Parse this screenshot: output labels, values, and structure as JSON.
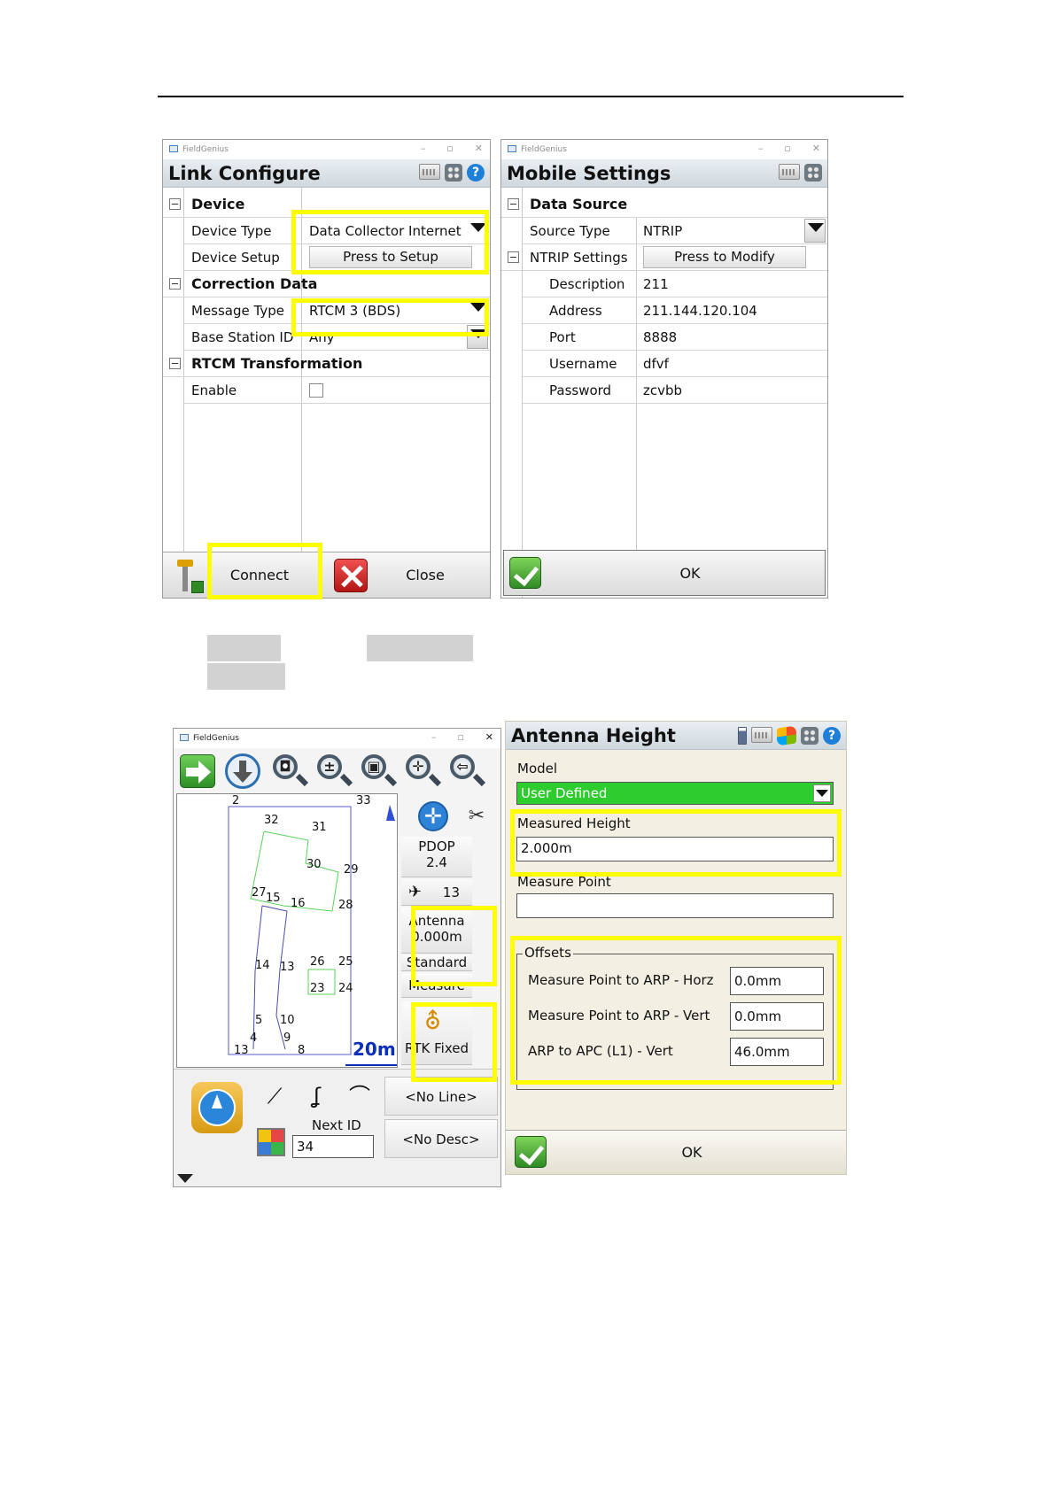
{
  "link_configure": {
    "app_name": "FieldGenius",
    "title": "Link Configure",
    "sections": {
      "device": "Device",
      "correction": "Correction Data",
      "rtcm": "RTCM Transformation"
    },
    "device_type_label": "Device Type",
    "device_type_value": "Data Collector Internet",
    "device_setup_label": "Device Setup",
    "device_setup_button": "Press to Setup",
    "message_type_label": "Message Type",
    "message_type_value": "RTCM 3 (BDS)",
    "base_station_label": "Base Station ID",
    "base_station_value": "Any",
    "enable_label": "Enable",
    "connect_label": "Connect",
    "close_label": "Close"
  },
  "mobile_settings": {
    "app_name": "FieldGenius",
    "title": "Mobile Settings",
    "section": "Data Source",
    "source_type_label": "Source Type",
    "source_type_value": "NTRIP",
    "ntrip_label": "NTRIP Settings",
    "ntrip_button": "Press to Modify",
    "rows": [
      {
        "label": "Description",
        "value": "211"
      },
      {
        "label": "Address",
        "value": "211.144.120.104"
      },
      {
        "label": "Port",
        "value": "8888"
      },
      {
        "label": "Username",
        "value": "dfvf"
      },
      {
        "label": "Password",
        "value": "zcvbb"
      }
    ],
    "ok_label": "OK"
  },
  "map_view": {
    "app_name": "FieldGenius",
    "points": [
      {
        "id": "2"
      },
      {
        "id": "33"
      },
      {
        "id": "32"
      },
      {
        "id": "31"
      },
      {
        "id": "30"
      },
      {
        "id": "29"
      },
      {
        "id": "27"
      },
      {
        "id": "15"
      },
      {
        "id": "16"
      },
      {
        "id": "28"
      },
      {
        "id": "14"
      },
      {
        "id": "13"
      },
      {
        "id": "26"
      },
      {
        "id": "25"
      },
      {
        "id": "23"
      },
      {
        "id": "24"
      },
      {
        "id": "5"
      },
      {
        "id": "10"
      },
      {
        "id": "4"
      },
      {
        "id": "9"
      },
      {
        "id": "13"
      },
      {
        "id": "8"
      }
    ],
    "scale_label": "20m",
    "pdop_label": "PDOP",
    "pdop_value": "2.4",
    "satellites": "13",
    "antenna_label": "Antenna",
    "antenna_value": "0.000m",
    "standard_label": "Standard",
    "measure_label": "Measure",
    "rtk_status": "RTK Fixed",
    "line_label": "<No Line>",
    "desc_label": "<No Desc>",
    "next_id_label": "Next ID",
    "next_id_value": "34"
  },
  "antenna_height": {
    "title": "Antenna Height",
    "model_label": "Model",
    "model_value": "User Defined",
    "measured_height_label": "Measured Height",
    "measured_height_value": "2.000m",
    "measure_point_label": "Measure Point",
    "measure_point_value": "",
    "offsets_label": "Offsets",
    "offsets": [
      {
        "label": "Measure Point to ARP - Horz",
        "value": "0.0mm"
      },
      {
        "label": "Measure Point to ARP - Vert",
        "value": "0.0mm"
      },
      {
        "label": "ARP to APC (L1) - Vert",
        "value": "46.0mm"
      }
    ],
    "ok_label": "OK"
  },
  "colors": {
    "highlight": "#ffff00",
    "model_green": "#2ecc2e",
    "header_gray": "#d5dde2"
  }
}
